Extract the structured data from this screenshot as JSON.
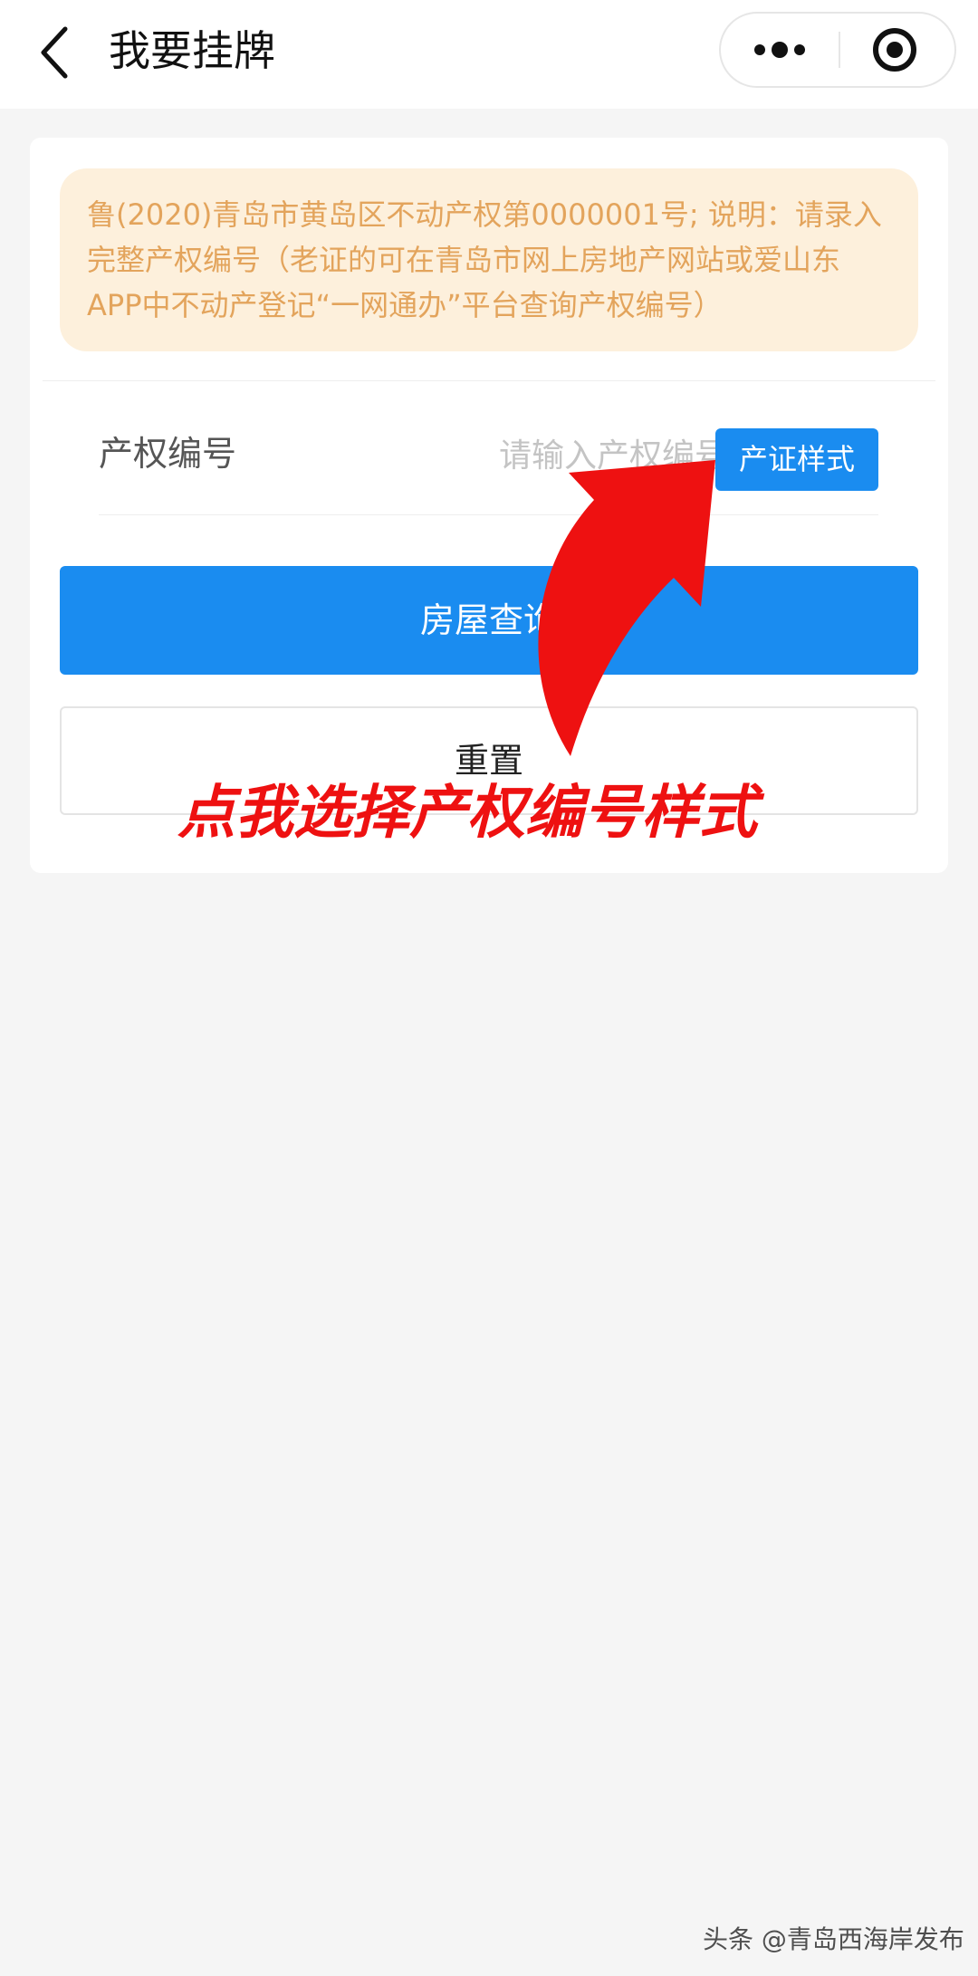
{
  "nav": {
    "title": "我要挂牌",
    "back_icon": "chevron-left-icon",
    "more_icon": "more-dots-icon",
    "close_icon": "target-icon"
  },
  "notice": {
    "text": "鲁(2020)青岛市黄岛区不动产权第0000001号; 说明：请录入完整产权编号（老证的可在青岛市网上房地产网站或爱山东APP中不动产登记“一网通办”平台查询产权编号）"
  },
  "form": {
    "label": "产权编号",
    "placeholder": "请输入产权编号",
    "value": "",
    "sample_button": "产证样式"
  },
  "buttons": {
    "query": "房屋查询",
    "reset": "重置"
  },
  "annotation": {
    "text": "点我选择产权编号样式",
    "arrow_icon": "curved-arrow-icon"
  },
  "watermark": "头条 @青岛西海岸发布",
  "colors": {
    "primary": "#1a8cf0",
    "notice_bg": "#fdf0dc",
    "notice_text": "#e3a45c",
    "annotation": "#ee1111",
    "page_bg": "#f5f5f5"
  }
}
